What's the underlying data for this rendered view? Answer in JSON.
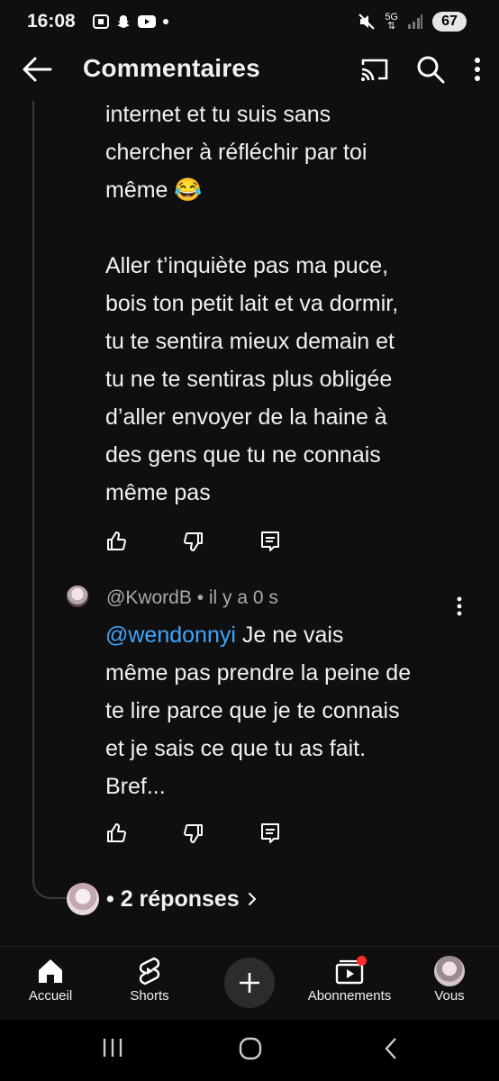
{
  "status": {
    "time": "16:08",
    "network": "5G",
    "battery": "67"
  },
  "appbar": {
    "title": "Commentaires"
  },
  "comment1": {
    "text": "internet et tu suis sans\nchercher à réfléchir par toi\nmême 😂\n\nAller t’inquiète pas ma puce,\nbois ton petit lait et va dormir,\ntu te sentira mieux demain et\ntu ne te sentiras plus obligée\nd’aller envoyer de la haine à\ndes gens que tu ne connais\nmême pas"
  },
  "reply": {
    "author": "@KwordB",
    "time": "il y a 0 s",
    "mention": "@wendonnyi",
    "text": " Je ne vais\nmême pas prendre la peine de\nte lire parce que je te connais\net je sais ce que tu as fait.\nBref..."
  },
  "replies": {
    "label": "• 2 réponses"
  },
  "nav": {
    "home": "Accueil",
    "shorts": "Shorts",
    "subscriptions": "Abonnements",
    "you": "Vous"
  },
  "colors": {
    "background": "#0f0f0f",
    "mention": "#3ea6ff",
    "notification": "#ff2a2a"
  }
}
